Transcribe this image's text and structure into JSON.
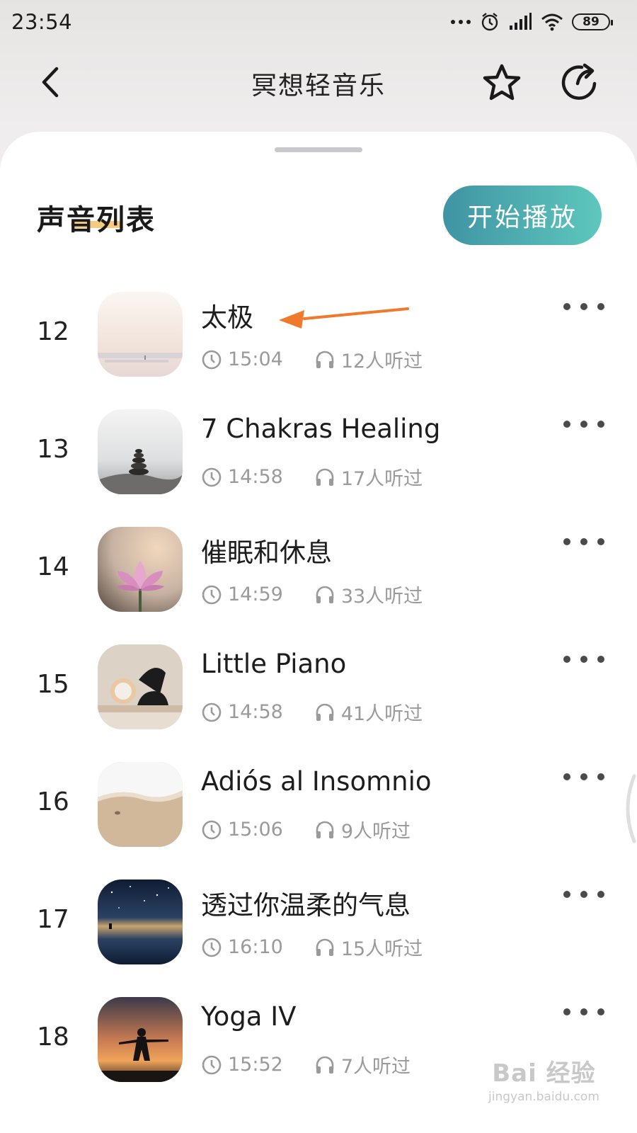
{
  "status_bar": {
    "time": "23:54",
    "battery": "89",
    "icons": [
      "more-dots-icon",
      "alarm-icon",
      "signal-icon",
      "wifi-icon",
      "battery-icon"
    ]
  },
  "nav": {
    "title": "冥想轻音乐",
    "back_icon": "chevron-left-icon",
    "favorite_icon": "star-icon",
    "share_icon": "share-refresh-icon"
  },
  "section": {
    "title": "声音列表",
    "play_label": "开始播放",
    "accent_underline": "#f5c473",
    "button_gradient": [
      "#3f94a3",
      "#5ec7bd"
    ]
  },
  "tracks": [
    {
      "index": "12",
      "title": "太极",
      "duration": "15:04",
      "listens": "12人听过",
      "thumb": "misty-sea"
    },
    {
      "index": "13",
      "title": "7 Chakras Healing",
      "duration": "14:58",
      "listens": "17人听过",
      "thumb": "stacked-stones"
    },
    {
      "index": "14",
      "title": "催眠和休息",
      "duration": "14:59",
      "listens": "33人听过",
      "thumb": "lotus-flower"
    },
    {
      "index": "15",
      "title": "Little Piano",
      "duration": "14:58",
      "listens": "41人听过",
      "thumb": "sculpture-shelf"
    },
    {
      "index": "16",
      "title": "Adiós al Insomnio",
      "duration": "15:06",
      "listens": "9人听过",
      "thumb": "beach-wave"
    },
    {
      "index": "17",
      "title": "透过你温柔的气息",
      "duration": "16:10",
      "listens": "15人听过",
      "thumb": "night-sky-lake"
    },
    {
      "index": "18",
      "title": "Yoga IV",
      "duration": "15:52",
      "listens": "7人听过",
      "thumb": "sunset-silhouette"
    }
  ],
  "annotation": {
    "arrow_color": "#f07a2a"
  },
  "watermark": {
    "logo": "Bai 经验",
    "sub": "jingyan.baidu.com"
  }
}
